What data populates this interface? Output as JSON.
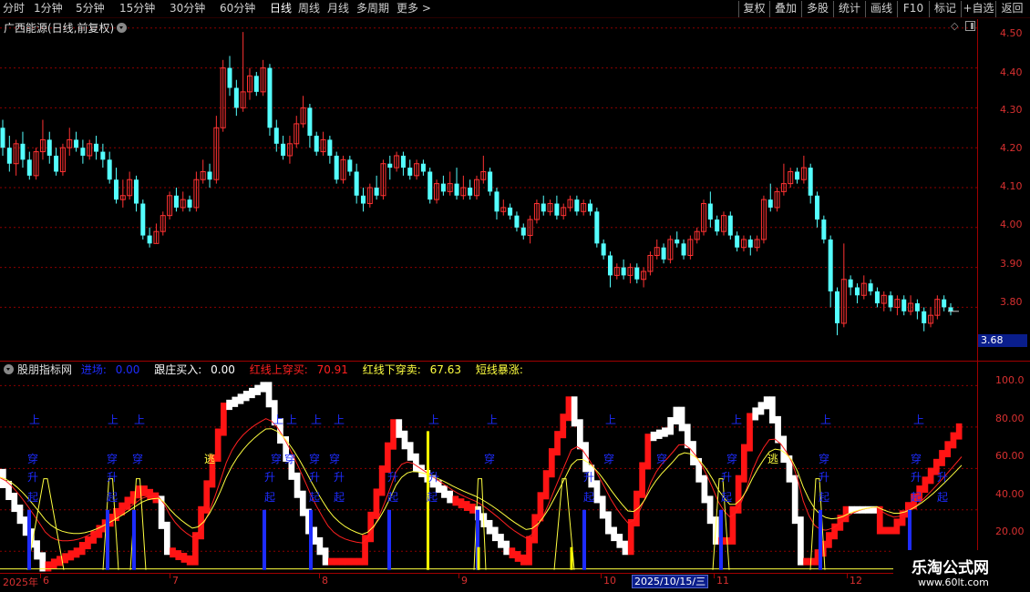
{
  "toolbar": {
    "periods": [
      "分时",
      "1分钟",
      "5分钟",
      "15分钟",
      "30分钟",
      "60分钟",
      "日线",
      "周线",
      "月线",
      "多周期",
      "更多"
    ],
    "active_period": "日线",
    "buttons": [
      "复权",
      "叠加",
      "多股",
      "统计",
      "画线",
      "F10",
      "标记",
      "+自选",
      "返回"
    ]
  },
  "main_chart": {
    "title": "广西能源(日线,前复权)",
    "price_ticks": [
      "4.50",
      "4.40",
      "4.30",
      "4.20",
      "4.10",
      "4.00",
      "3.90",
      "3.80"
    ],
    "last_price_tag": "3.68"
  },
  "indicator": {
    "name": "股朋指标网",
    "fields": [
      {
        "label": "进场:",
        "value": "0.00",
        "color": "#1e2cff"
      },
      {
        "label": "跟庄买入:",
        "value": "0.00",
        "color": "#ffffff"
      },
      {
        "label": "红线上穿买:",
        "value": "70.91",
        "color": "#ff2020"
      },
      {
        "label": "红线下穿卖:",
        "value": "67.63",
        "color": "#ffff40"
      },
      {
        "label": "短线暴涨:",
        "value": "",
        "color": "#ffff40"
      }
    ],
    "ticks": [
      "100.0",
      "80.00",
      "60.00",
      "40.00",
      "20.00"
    ],
    "signal_labels": {
      "up": "上",
      "cross": "穿",
      "rise": "升",
      "start": "起",
      "escape": "逃"
    }
  },
  "date_axis": {
    "labels": [
      "2025年",
      "6",
      "7",
      "8",
      "9",
      "10",
      "11",
      "12"
    ],
    "cursor_date": "2025/10/15/三"
  },
  "watermark": {
    "title": "乐淘公式网",
    "url": "www.60lt.com"
  },
  "colors": {
    "up_candle": "#ff3232",
    "down_candle": "#54ffff",
    "grid": "#8c0000",
    "red_line": "#ff2020",
    "yellow_line": "#ffff40",
    "signal_blue": "#1e2cff"
  },
  "chart_data": {
    "type": "candlestick",
    "price_axis_range": [
      3.68,
      4.52
    ],
    "candles": [
      [
        4.25,
        4.2,
        4.27,
        4.18
      ],
      [
        4.2,
        4.16,
        4.23,
        4.14
      ],
      [
        4.16,
        4.21,
        4.22,
        4.13
      ],
      [
        4.21,
        4.17,
        4.24,
        4.15
      ],
      [
        4.17,
        4.13,
        4.19,
        4.12
      ],
      [
        4.13,
        4.19,
        4.2,
        4.12
      ],
      [
        4.19,
        4.22,
        4.27,
        4.17
      ],
      [
        4.22,
        4.18,
        4.24,
        4.16
      ],
      [
        4.18,
        4.14,
        4.2,
        4.13
      ],
      [
        4.14,
        4.2,
        4.21,
        4.13
      ],
      [
        4.2,
        4.22,
        4.25,
        4.18
      ],
      [
        4.22,
        4.2,
        4.24,
        4.19
      ],
      [
        4.2,
        4.18,
        4.22,
        4.16
      ],
      [
        4.18,
        4.21,
        4.22,
        4.17
      ],
      [
        4.21,
        4.19,
        4.23,
        4.17
      ],
      [
        4.19,
        4.17,
        4.21,
        4.15
      ],
      [
        4.17,
        4.12,
        4.19,
        4.11
      ],
      [
        4.12,
        4.07,
        4.15,
        4.06
      ],
      [
        4.07,
        4.08,
        4.12,
        4.05
      ],
      [
        4.08,
        4.12,
        4.14,
        4.07
      ],
      [
        4.12,
        4.06,
        4.13,
        4.04
      ],
      [
        4.06,
        3.98,
        4.07,
        3.97
      ],
      [
        3.98,
        3.96,
        4.0,
        3.95
      ],
      [
        3.96,
        3.99,
        4.01,
        3.96
      ],
      [
        3.99,
        4.03,
        4.04,
        3.98
      ],
      [
        4.03,
        4.08,
        4.09,
        4.02
      ],
      [
        4.08,
        4.05,
        4.1,
        4.04
      ],
      [
        4.05,
        4.07,
        4.09,
        4.04
      ],
      [
        4.07,
        4.05,
        4.08,
        4.04
      ],
      [
        4.05,
        4.12,
        4.14,
        4.04
      ],
      [
        4.12,
        4.14,
        4.17,
        4.11
      ],
      [
        4.14,
        4.12,
        4.16,
        4.1
      ],
      [
        4.12,
        4.25,
        4.28,
        4.11
      ],
      [
        4.25,
        4.4,
        4.42,
        4.24
      ],
      [
        4.4,
        4.35,
        4.43,
        4.33
      ],
      [
        4.35,
        4.3,
        4.37,
        4.28
      ],
      [
        4.3,
        4.34,
        4.49,
        4.29
      ],
      [
        4.34,
        4.38,
        4.4,
        4.32
      ],
      [
        4.38,
        4.34,
        4.39,
        4.33
      ],
      [
        4.34,
        4.4,
        4.42,
        4.33
      ],
      [
        4.4,
        4.25,
        4.41,
        4.23
      ],
      [
        4.25,
        4.21,
        4.27,
        4.19
      ],
      [
        4.21,
        4.18,
        4.23,
        4.17
      ],
      [
        4.18,
        4.21,
        4.23,
        4.16
      ],
      [
        4.21,
        4.26,
        4.28,
        4.2
      ],
      [
        4.26,
        4.3,
        4.33,
        4.25
      ],
      [
        4.3,
        4.23,
        4.31,
        4.2
      ],
      [
        4.23,
        4.19,
        4.24,
        4.18
      ],
      [
        4.19,
        4.22,
        4.24,
        4.18
      ],
      [
        4.22,
        4.18,
        4.23,
        4.16
      ],
      [
        4.18,
        4.12,
        4.19,
        4.11
      ],
      [
        4.12,
        4.17,
        4.18,
        4.11
      ],
      [
        4.17,
        4.14,
        4.18,
        4.13
      ],
      [
        4.14,
        4.08,
        4.16,
        4.06
      ],
      [
        4.08,
        4.06,
        4.1,
        4.04
      ],
      [
        4.06,
        4.1,
        4.11,
        4.05
      ],
      [
        4.1,
        4.08,
        4.13,
        4.07
      ],
      [
        4.08,
        4.16,
        4.17,
        4.07
      ],
      [
        4.16,
        4.15,
        4.18,
        4.12
      ],
      [
        4.15,
        4.18,
        4.19,
        4.14
      ],
      [
        4.18,
        4.15,
        4.19,
        4.13
      ],
      [
        4.15,
        4.13,
        4.17,
        4.12
      ],
      [
        4.13,
        4.16,
        4.17,
        4.12
      ],
      [
        4.16,
        4.14,
        4.17,
        4.13
      ],
      [
        4.14,
        4.07,
        4.15,
        4.06
      ],
      [
        4.07,
        4.11,
        4.12,
        4.06
      ],
      [
        4.11,
        4.09,
        4.13,
        4.08
      ],
      [
        4.09,
        4.11,
        4.14,
        4.08
      ],
      [
        4.11,
        4.08,
        4.15,
        4.07
      ],
      [
        4.08,
        4.1,
        4.13,
        4.07
      ],
      [
        4.1,
        4.08,
        4.12,
        4.07
      ],
      [
        4.08,
        4.12,
        4.13,
        4.07
      ],
      [
        4.12,
        4.14,
        4.18,
        4.11
      ],
      [
        4.14,
        4.09,
        4.15,
        4.08
      ],
      [
        4.09,
        4.04,
        4.1,
        4.02
      ],
      [
        4.04,
        4.05,
        4.07,
        4.03
      ],
      [
        4.05,
        4.03,
        4.06,
        4.02
      ],
      [
        4.03,
        4.0,
        4.04,
        3.99
      ],
      [
        4.0,
        3.98,
        4.01,
        3.97
      ],
      [
        3.98,
        4.02,
        4.03,
        3.96
      ],
      [
        4.02,
        4.06,
        4.07,
        4.01
      ],
      [
        4.06,
        4.04,
        4.08,
        4.03
      ],
      [
        4.04,
        4.06,
        4.07,
        4.03
      ],
      [
        4.06,
        4.03,
        4.08,
        4.02
      ],
      [
        4.03,
        4.05,
        4.06,
        4.02
      ],
      [
        4.05,
        4.07,
        4.08,
        4.04
      ],
      [
        4.07,
        4.04,
        4.08,
        4.03
      ],
      [
        4.04,
        4.06,
        4.07,
        4.03
      ],
      [
        4.06,
        4.04,
        4.07,
        4.03
      ],
      [
        4.04,
        3.96,
        4.05,
        3.95
      ],
      [
        3.96,
        3.93,
        3.97,
        3.92
      ],
      [
        3.93,
        3.88,
        3.94,
        3.85
      ],
      [
        3.88,
        3.9,
        3.91,
        3.87
      ],
      [
        3.9,
        3.88,
        3.92,
        3.87
      ],
      [
        3.88,
        3.9,
        3.91,
        3.86
      ],
      [
        3.9,
        3.87,
        3.91,
        3.86
      ],
      [
        3.87,
        3.89,
        3.9,
        3.85
      ],
      [
        3.89,
        3.93,
        3.94,
        3.88
      ],
      [
        3.93,
        3.95,
        3.97,
        3.92
      ],
      [
        3.95,
        3.92,
        3.96,
        3.91
      ],
      [
        3.92,
        3.97,
        3.98,
        3.91
      ],
      [
        3.97,
        3.96,
        3.99,
        3.95
      ],
      [
        3.96,
        3.93,
        3.97,
        3.92
      ],
      [
        3.93,
        3.97,
        3.98,
        3.92
      ],
      [
        3.97,
        3.99,
        4.0,
        3.96
      ],
      [
        3.99,
        4.06,
        4.07,
        3.98
      ],
      [
        4.06,
        4.02,
        4.09,
        4.0
      ],
      [
        4.02,
        3.99,
        4.03,
        3.98
      ],
      [
        3.99,
        4.03,
        4.04,
        3.98
      ],
      [
        4.03,
        3.98,
        4.04,
        3.97
      ],
      [
        3.98,
        3.95,
        3.99,
        3.94
      ],
      [
        3.95,
        3.97,
        3.98,
        3.94
      ],
      [
        3.97,
        3.95,
        3.98,
        3.93
      ],
      [
        3.95,
        3.97,
        3.98,
        3.94
      ],
      [
        3.97,
        4.07,
        4.08,
        3.96
      ],
      [
        4.07,
        4.05,
        4.11,
        4.04
      ],
      [
        4.05,
        4.09,
        4.1,
        4.04
      ],
      [
        4.09,
        4.11,
        4.16,
        4.08
      ],
      [
        4.11,
        4.14,
        4.15,
        4.1
      ],
      [
        4.14,
        4.12,
        4.15,
        4.11
      ],
      [
        4.12,
        4.15,
        4.18,
        4.11
      ],
      [
        4.15,
        4.08,
        4.16,
        4.06
      ],
      [
        4.08,
        4.02,
        4.09,
        4.0
      ],
      [
        4.02,
        3.97,
        4.03,
        3.96
      ],
      [
        3.97,
        3.84,
        3.98,
        3.8
      ],
      [
        3.84,
        3.76,
        3.85,
        3.73
      ],
      [
        3.76,
        3.87,
        3.96,
        3.75
      ],
      [
        3.87,
        3.85,
        3.88,
        3.83
      ],
      [
        3.85,
        3.83,
        3.86,
        3.81
      ],
      [
        3.83,
        3.86,
        3.88,
        3.82
      ],
      [
        3.86,
        3.84,
        3.87,
        3.83
      ],
      [
        3.84,
        3.81,
        3.85,
        3.8
      ],
      [
        3.81,
        3.83,
        3.84,
        3.79
      ],
      [
        3.83,
        3.8,
        3.84,
        3.79
      ],
      [
        3.8,
        3.82,
        3.83,
        3.78
      ],
      [
        3.82,
        3.79,
        3.83,
        3.78
      ],
      [
        3.79,
        3.81,
        3.83,
        3.78
      ],
      [
        3.81,
        3.79,
        3.82,
        3.77
      ],
      [
        3.79,
        3.76,
        3.8,
        3.74
      ],
      [
        3.76,
        3.78,
        3.8,
        3.75
      ],
      [
        3.78,
        3.82,
        3.83,
        3.77
      ],
      [
        3.82,
        3.8,
        3.83,
        3.79
      ],
      [
        3.8,
        3.79,
        3.81,
        3.78
      ]
    ],
    "indicator_axis_range": [
      10,
      105
    ]
  }
}
